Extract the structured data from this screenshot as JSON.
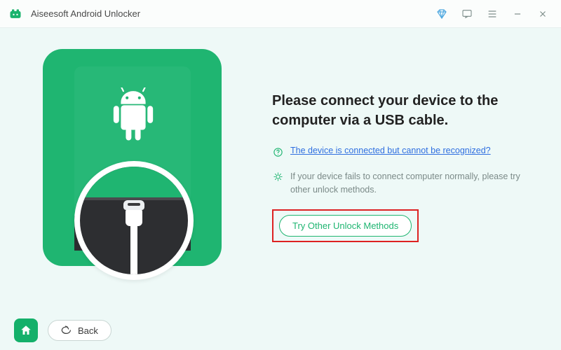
{
  "titlebar": {
    "app_name": "Aiseesoft Android Unlocker"
  },
  "main": {
    "headline": "Please connect your device to the computer via a USB cable.",
    "help_link": "The device is connected but cannot be recognized?",
    "tip_text": "If your device fails to connect computer normally, please try other unlock methods.",
    "cta_label": "Try Other Unlock Methods"
  },
  "footer": {
    "back_label": "Back"
  }
}
